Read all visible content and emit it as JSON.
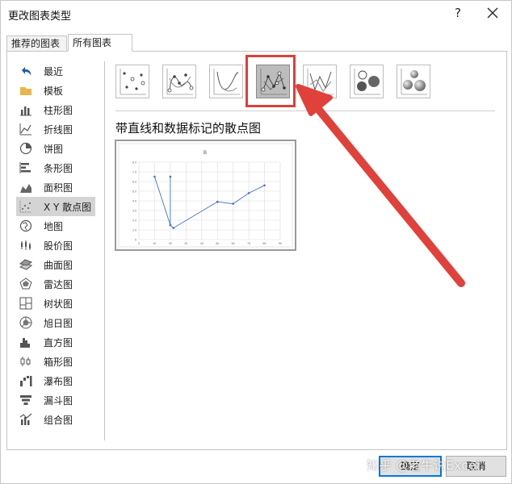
{
  "window": {
    "title": "更改图表类型",
    "help_label": "?"
  },
  "tabs": [
    {
      "label": "推荐的图表",
      "active": false
    },
    {
      "label": "所有图表",
      "active": true
    }
  ],
  "sidebar": {
    "items": [
      {
        "label": "最近",
        "icon": "undo-icon"
      },
      {
        "label": "模板",
        "icon": "folder-icon"
      },
      {
        "label": "柱形图",
        "icon": "column-chart-icon"
      },
      {
        "label": "折线图",
        "icon": "line-chart-icon"
      },
      {
        "label": "饼图",
        "icon": "pie-chart-icon"
      },
      {
        "label": "条形图",
        "icon": "bar-chart-icon"
      },
      {
        "label": "面积图",
        "icon": "area-chart-icon"
      },
      {
        "label": "X Y 散点图",
        "icon": "scatter-chart-icon",
        "selected": true
      },
      {
        "label": "地图",
        "icon": "map-icon"
      },
      {
        "label": "股价图",
        "icon": "stock-chart-icon"
      },
      {
        "label": "曲面图",
        "icon": "surface-chart-icon"
      },
      {
        "label": "雷达图",
        "icon": "radar-chart-icon"
      },
      {
        "label": "树状图",
        "icon": "treemap-icon"
      },
      {
        "label": "旭日图",
        "icon": "sunburst-icon"
      },
      {
        "label": "直方图",
        "icon": "histogram-icon"
      },
      {
        "label": "箱形图",
        "icon": "box-whisker-icon"
      },
      {
        "label": "瀑布图",
        "icon": "waterfall-icon"
      },
      {
        "label": "漏斗图",
        "icon": "funnel-icon"
      },
      {
        "label": "组合图",
        "icon": "combo-chart-icon"
      }
    ]
  },
  "subtypes": [
    {
      "icon": "scatter-only-icon"
    },
    {
      "icon": "scatter-smooth-markers-icon"
    },
    {
      "icon": "scatter-smooth-lines-icon"
    },
    {
      "icon": "scatter-straight-markers-icon",
      "selected": true
    },
    {
      "icon": "scatter-straight-lines-icon"
    },
    {
      "icon": "bubble-icon"
    },
    {
      "icon": "bubble-3d-icon"
    }
  ],
  "selected_subtype_title": "带直线和数据标记的散点图",
  "preview": {
    "chart_data": {
      "type": "line",
      "title": "B",
      "x": [
        10,
        20,
        20,
        20,
        22,
        50,
        60,
        70,
        80
      ],
      "y": [
        6.5,
        1.5,
        6.5,
        1.5,
        1.2,
        3.9,
        3.7,
        4.8,
        5.6
      ],
      "xlim": [
        0,
        90
      ],
      "ylim": [
        0,
        8
      ],
      "x_ticks": [
        "0",
        "10",
        "20",
        "30",
        "40",
        "50",
        "60",
        "70",
        "80",
        "90"
      ],
      "y_ticks": [
        "0",
        "1.0",
        "2.0",
        "3.0",
        "4.0",
        "5.0",
        "6.0",
        "7.0",
        "8.0"
      ],
      "grid": true,
      "line_color": "#4472c4"
    }
  },
  "buttons": {
    "ok_label": "确定",
    "cancel_label": "取消"
  },
  "watermark": "知乎 @老牛说Excel",
  "colors": {
    "highlight": "#d9413a",
    "accent": "#0078d7"
  }
}
